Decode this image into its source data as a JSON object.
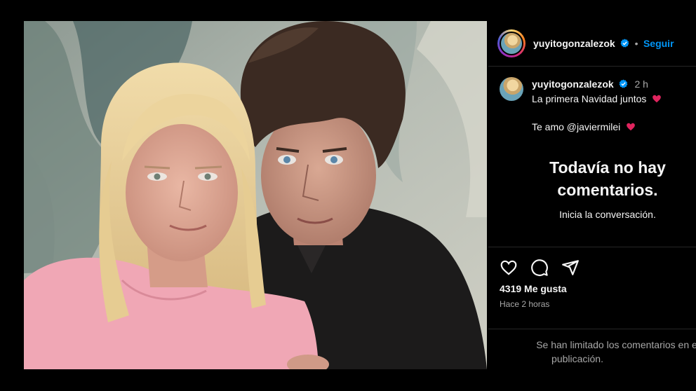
{
  "post": {
    "username": "yuyitogonzalezok",
    "follow_label": "Seguir",
    "separator": "•",
    "time": "2 h",
    "caption_line1": "La primera Navidad juntos",
    "caption_line2": "Te amo @javiermilei",
    "likes": "4319 Me gusta",
    "posted_ago": "Hace 2 horas"
  },
  "comments": {
    "empty_title_line1": "Todavía no hay",
    "empty_title_line2": "comentarios.",
    "empty_subtitle": "Inicia la conversación.",
    "limited_line1": "Se han limitado los comentarios en e",
    "limited_line2": "publicación."
  },
  "icons": {
    "like": "heart-outline-icon",
    "comment": "speech-bubble-icon",
    "share": "paper-plane-icon",
    "verified": "verified-badge-icon",
    "emoji": "red-heart-emoji"
  },
  "colors": {
    "background": "#000000",
    "text": "#f5f5f5",
    "muted": "#a8a8a8",
    "link": "#0095f6",
    "verified": "#0095f6",
    "divider": "#262626",
    "heart": "#e0245e"
  }
}
